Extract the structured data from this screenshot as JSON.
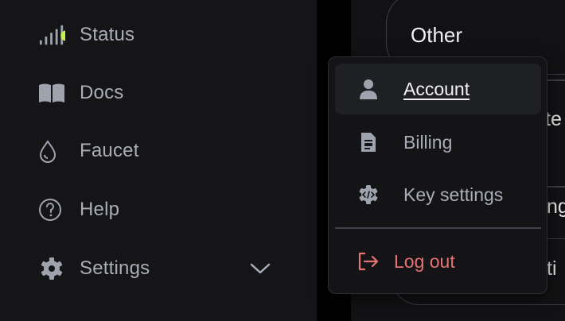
{
  "sidebar": {
    "items": [
      {
        "label": "Status",
        "icon": "signal-status-icon"
      },
      {
        "label": "Docs",
        "icon": "book-icon"
      },
      {
        "label": "Faucet",
        "icon": "droplet-icon"
      },
      {
        "label": "Help",
        "icon": "help-circle-icon"
      },
      {
        "label": "Settings",
        "icon": "gear-icon"
      }
    ],
    "status_dot_color": "#c6f24d"
  },
  "panel": {
    "other_label": "Other",
    "frag1": "te",
    "frag2": "ng",
    "frag3": "ti"
  },
  "menu": {
    "items": [
      {
        "label": "Account",
        "icon": "user-icon"
      },
      {
        "label": "Billing",
        "icon": "invoice-icon"
      },
      {
        "label": "Key settings",
        "icon": "code-gear-icon"
      }
    ],
    "logout_label": "Log out",
    "logout_color": "#e57373"
  }
}
